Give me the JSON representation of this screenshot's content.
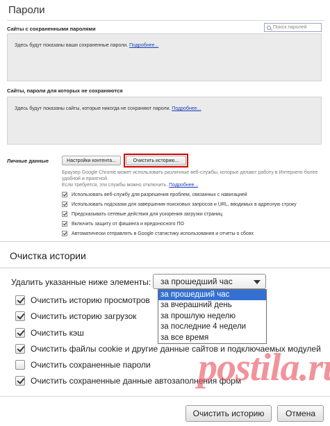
{
  "settings": {
    "title": "Пароли",
    "search_placeholder": "Поиск паролей",
    "saved_section": {
      "label": "Сайты с сохраненными паролями",
      "text": "Здесь будут показаны ваши сохраненные пароли.",
      "link": "Подробнее..."
    },
    "never_section": {
      "label": "Сайты, пароли для которых не сохраняются",
      "text": "Здесь будут показаны сайты, которые никогда не сохраняют пароли.",
      "link": "Подробнее..."
    },
    "privacy": {
      "label": "Личные данные",
      "content_settings_button": "Настройки контента...",
      "clear_history_button": "Очистить историю...",
      "description_1": "Браузер Google Chrome может использовать различные веб-службы, которые делают работу в Интернете более удобной и приятной.",
      "description_2": "Если требуется, эти службы можно отключить.",
      "description_link": "Подробнее...",
      "options": [
        {
          "label": "Использовать веб-службу для разрешения проблем, связанных с навигацией",
          "checked": true
        },
        {
          "label": "Использовать подсказки для завершения поисковых запросов и URL, вводимых в адресную строку",
          "checked": true
        },
        {
          "label": "Предсказывать сетевые действия для ускорения загрузки страниц",
          "checked": true
        },
        {
          "label": "Включить защиту от фишинга и вредоносного ПО",
          "checked": true
        },
        {
          "label": "Автоматически отправлять в Google статистику использования и отчеты о сбоях",
          "checked": true
        }
      ]
    }
  },
  "dialog": {
    "title": "Очистка истории",
    "range_label": "Удалить указанные ниже элементы:",
    "range_selected": "за прошедший час",
    "range_options": [
      {
        "label": "за прошедший час",
        "selected": true
      },
      {
        "label": "за вчерашний день",
        "selected": false
      },
      {
        "label": "за прошлую неделю",
        "selected": false
      },
      {
        "label": "за последние 4 недели",
        "selected": false
      },
      {
        "label": "за все время",
        "selected": false
      }
    ],
    "items": [
      {
        "label": "Очистить историю просмотров",
        "checked": true
      },
      {
        "label": "Очистить историю загрузок",
        "checked": true
      },
      {
        "label": "Очистить кэш",
        "checked": true
      },
      {
        "label": "Очистить файлы cookie и другие данные сайтов и подключаемых модулей",
        "checked": true
      },
      {
        "label": "Очистить сохраненные пароли",
        "checked": false
      },
      {
        "label": "Очистить сохраненные данные автозаполнения форм",
        "checked": true
      }
    ],
    "clear_button": "Очистить историю",
    "cancel_button": "Отмена"
  },
  "watermark": "postila.ru",
  "colors": {
    "link": "#1a3fb5",
    "highlight_outline": "#d40000",
    "dropdown_selection": "#3470d0"
  }
}
